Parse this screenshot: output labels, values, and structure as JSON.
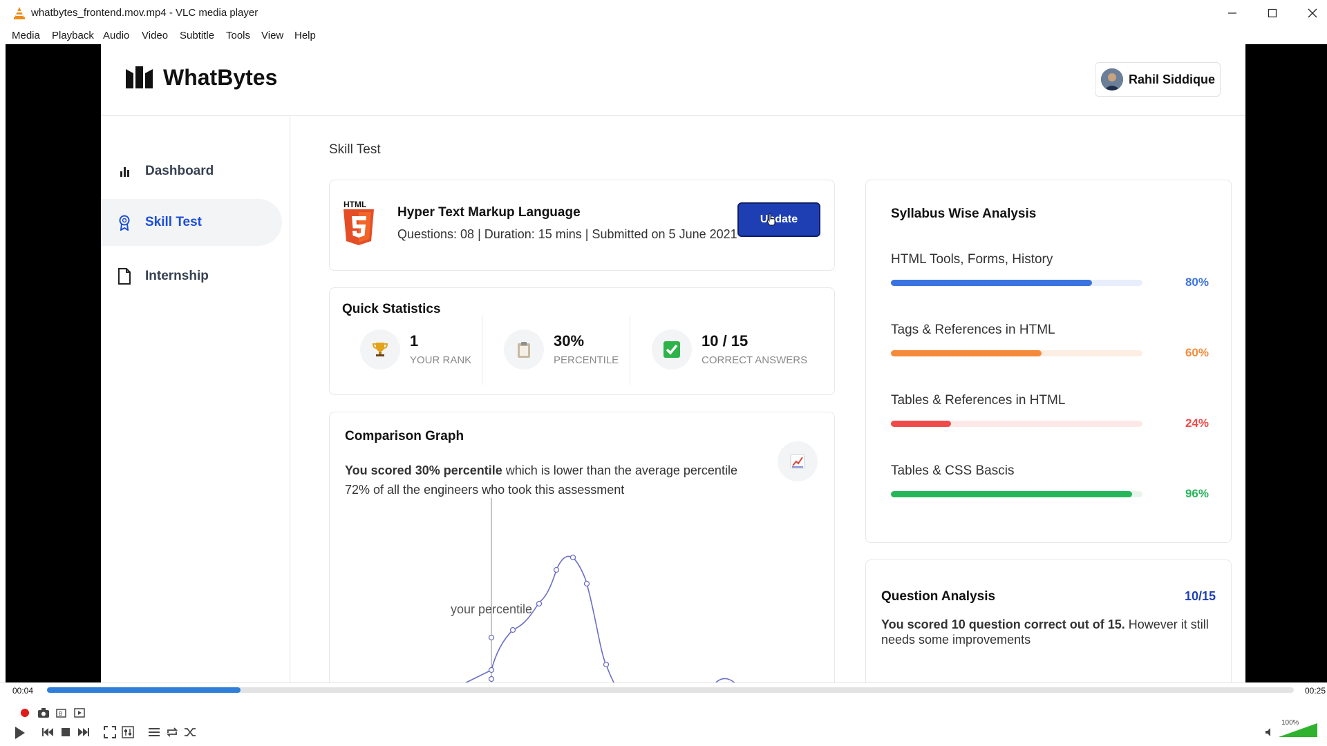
{
  "window": {
    "title": "whatbytes_frontend.mov.mp4 - VLC media player",
    "menu": [
      "Media",
      "Playback",
      "Audio",
      "Video",
      "Subtitle",
      "Tools",
      "View",
      "Help"
    ]
  },
  "player": {
    "elapsed": "00:04",
    "total": "00:25",
    "progress": 0.155,
    "volume_label": "100%",
    "volume": 1.0
  },
  "app": {
    "brand": "WhatBytes",
    "user_name": "Rahil Siddique",
    "sidebar": [
      {
        "label": "Dashboard",
        "icon": "bar-chart-icon",
        "active": false
      },
      {
        "label": "Skill Test",
        "icon": "award-icon",
        "active": true
      },
      {
        "label": "Internship",
        "icon": "file-icon",
        "active": false
      }
    ],
    "breadcrumb": "Skill Test",
    "test": {
      "badge": "HTML",
      "title": "Hyper Text Markup Language",
      "meta": "Questions: 08 | Duration: 15 mins | Submitted on 5 June 2021",
      "update_label": "Update"
    },
    "quick_stats": {
      "title": "Quick Statistics",
      "items": [
        {
          "value": "1",
          "caption": "YOUR RANK",
          "icon": "trophy-icon"
        },
        {
          "value": "30%",
          "caption": "PERCENTILE",
          "icon": "clipboard-icon"
        },
        {
          "value": "10 / 15",
          "caption": "CORRECT ANSWERS",
          "icon": "checkmark-icon"
        }
      ]
    },
    "comparison": {
      "title": "Comparison Graph",
      "desc_bold": "You scored 30% percentile",
      "desc_rest": " which is lower than the average percentile 72% of all the engineers who took this assessment",
      "marker_label": "your percentile"
    },
    "syllabus": {
      "title": "Syllabus Wise Analysis",
      "rows": [
        {
          "label": "HTML Tools, Forms, History",
          "value": 80,
          "pct": "80%",
          "color": "#3b74e0",
          "track": "#e8eefb"
        },
        {
          "label": "Tags & References in HTML",
          "value": 60,
          "pct": "60%",
          "color": "#f58a3a",
          "track": "#fdeee4"
        },
        {
          "label": "Tables & References in HTML",
          "value": 24,
          "pct": "24%",
          "color": "#ef4b4b",
          "track": "#fde8e8"
        },
        {
          "label": "Tables & CSS Bascis",
          "value": 96,
          "pct": "96%",
          "color": "#27b55a",
          "track": "#e6f5ec"
        }
      ]
    },
    "question_analysis": {
      "title": "Question Analysis",
      "score": "10/15",
      "desc_bold": "You scored 10 question correct out of 15.",
      "desc_rest": " However it still needs some improvements"
    }
  }
}
